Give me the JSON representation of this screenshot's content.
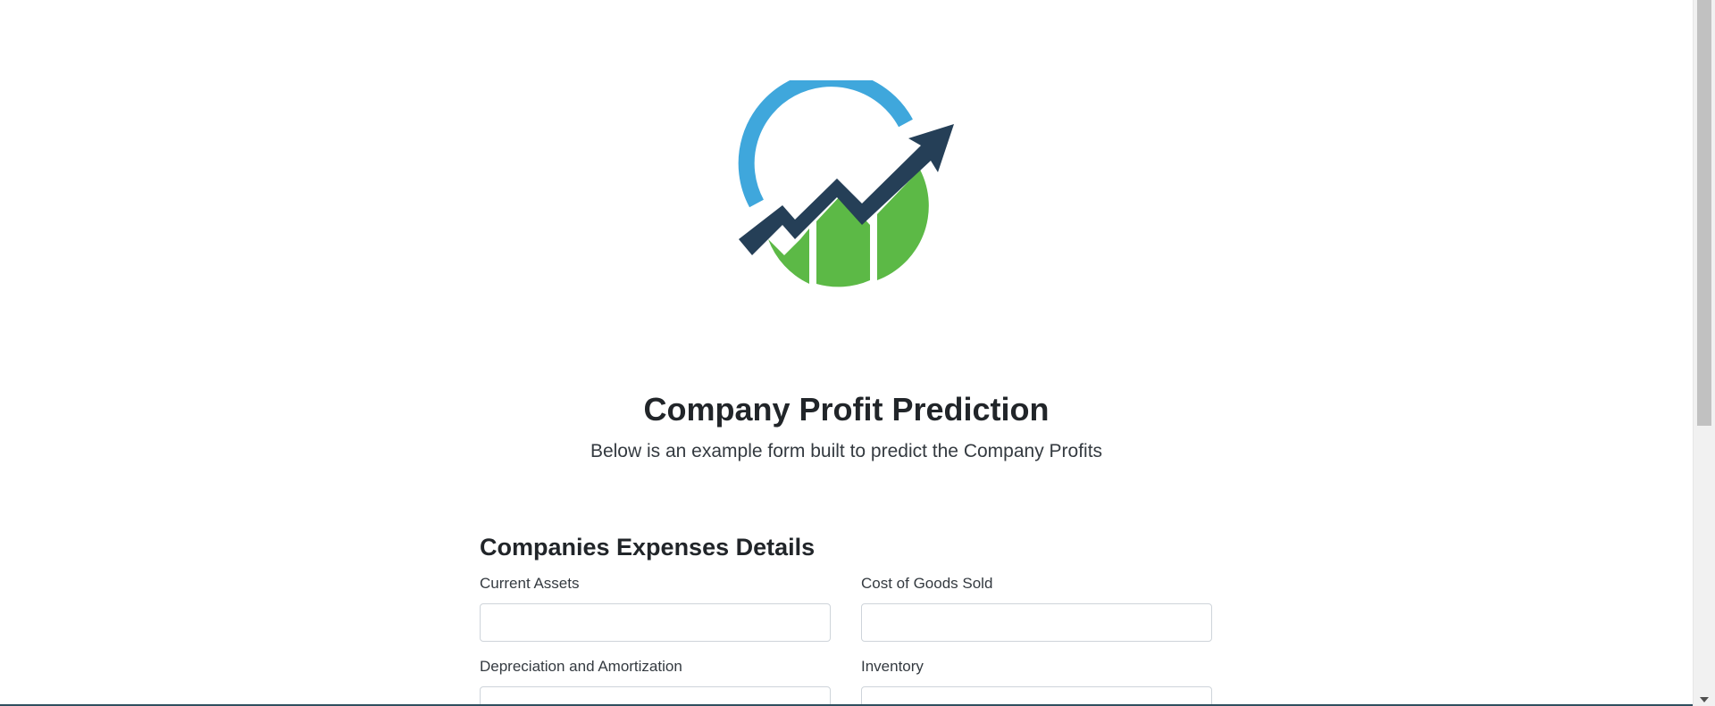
{
  "logo": {
    "icon": "profit-growth-logo",
    "colors": {
      "ring": "#3fa7dc",
      "arrow": "#253f57",
      "bars": "#5cb946"
    }
  },
  "header": {
    "title": "Company Profit Prediction",
    "subtitle": "Below is an example form built to predict the Company Profits"
  },
  "form": {
    "section_title": "Companies Expenses Details",
    "fields": [
      {
        "label": "Current Assets",
        "value": ""
      },
      {
        "label": "Cost of Goods Sold",
        "value": ""
      },
      {
        "label": "Depreciation and Amortization",
        "value": ""
      },
      {
        "label": "Inventory",
        "value": ""
      }
    ]
  }
}
